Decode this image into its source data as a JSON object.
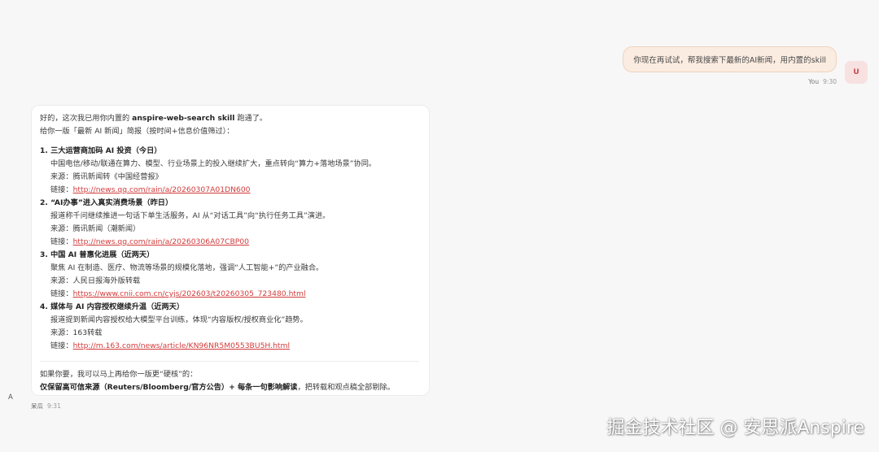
{
  "user_message": {
    "text": "你现在再试试，帮我搜索下最新的AI新闻，用内置的skill",
    "avatar_letter": "U",
    "sender": "You",
    "time": "9:30"
  },
  "assistant_message": {
    "avatar_letter": "A",
    "sender": "呆瓜",
    "time": "9:31",
    "intro_prefix": "好的，这次我已用你内置的 ",
    "intro_skill": "anspire-web-search skill",
    "intro_suffix": " 跑通了。",
    "intro_line2": "给你一版「最新 AI 新闻」简报（按时间+信息价值筛过）：",
    "items": [
      {
        "title": "1. 三大运营商加码 AI 投资（今日）",
        "summary": "中国电信/移动/联通在算力、模型、行业场景上的投入继续扩大，重点转向“算力+落地场景”协同。",
        "source": "来源：腾讯新闻转《中国经营报》",
        "link_label": "链接：",
        "link": "http://news.qq.com/rain/a/20260307A01DN600"
      },
      {
        "title": "2. “AI办事”进入真实消费场景（昨日）",
        "summary": "报道称千问继续推进一句话下单生活服务，AI 从“对话工具”向“执行任务工具”演进。",
        "source": "来源：腾讯新闻（潮新闻）",
        "link_label": "链接：",
        "link": "http://news.qq.com/rain/a/20260306A07CBP00"
      },
      {
        "title": "3. 中国 AI 普惠化进展（近两天）",
        "summary": "聚焦 AI 在制造、医疗、物流等场景的规模化落地，强调“人工智能+”的产业融合。",
        "source": "来源：人民日报海外版转载",
        "link_label": "链接：",
        "link": "https://www.cnii.com.cn/cyjs/202603/t20260305_723480.html"
      },
      {
        "title": "4. 媒体与 AI 内容授权继续升温（近两天）",
        "summary": "报道提到新闻内容授权给大模型平台训练，体现“内容版权/授权商业化”趋势。",
        "source": "来源：163转载",
        "link_label": "链接：",
        "link": "http://m.163.com/news/article/KN96NR5M0553BU5H.html"
      }
    ],
    "outro_line1": "如果你要，我可以马上再给你一版更“硬核”的：",
    "outro_bold": "仅保留高可信来源（Reuters/Bloomberg/官方公告）+ 每条一句影响解读",
    "outro_suffix": "，把转载和观点稿全部剔除。"
  },
  "watermark": "掘金技术社区 @ 安思派Anspire"
}
